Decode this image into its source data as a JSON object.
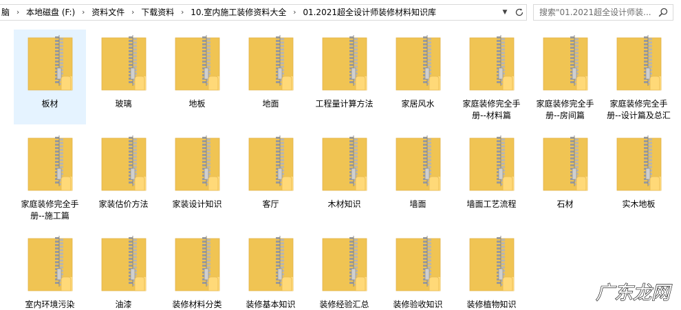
{
  "address_bar": {
    "breadcrumbs": [
      "脑",
      "本地磁盘 (F:)",
      "资料文件",
      "下载资料",
      "10.室内施工装修资料大全",
      "01.2021超全设计师装修材料知识库"
    ]
  },
  "search": {
    "placeholder": "搜索\"01.2021超全设计师装..."
  },
  "items": [
    {
      "label": "板材",
      "selected": true
    },
    {
      "label": "玻璃"
    },
    {
      "label": "地板"
    },
    {
      "label": "地面"
    },
    {
      "label": "工程量计算方法"
    },
    {
      "label": "家居风水"
    },
    {
      "label": "家庭装修完全手册--材料篇"
    },
    {
      "label": "家庭装修完全手册--房间篇"
    },
    {
      "label": "家庭装修完全手册--设计篇及总汇"
    },
    {
      "label": "家庭装修完全手册--施工篇"
    },
    {
      "label": "家装估价方法"
    },
    {
      "label": "家装设计知识"
    },
    {
      "label": "客厅"
    },
    {
      "label": "木材知识"
    },
    {
      "label": "墙面"
    },
    {
      "label": "墙面工艺流程"
    },
    {
      "label": "石材"
    },
    {
      "label": "实木地板"
    },
    {
      "label": "室内环境污染"
    },
    {
      "label": "油漆"
    },
    {
      "label": "装修材料分类"
    },
    {
      "label": "装修基本知识"
    },
    {
      "label": "装修经验汇总"
    },
    {
      "label": "装修验收知识"
    },
    {
      "label": "装修植物知识"
    }
  ],
  "watermark": {
    "text": "广东龙网"
  },
  "colors": {
    "selection": "#e5f3ff",
    "folder_back": "#f0c453",
    "folder_front": "#ffd978",
    "zipper": "#9a9a9a"
  }
}
